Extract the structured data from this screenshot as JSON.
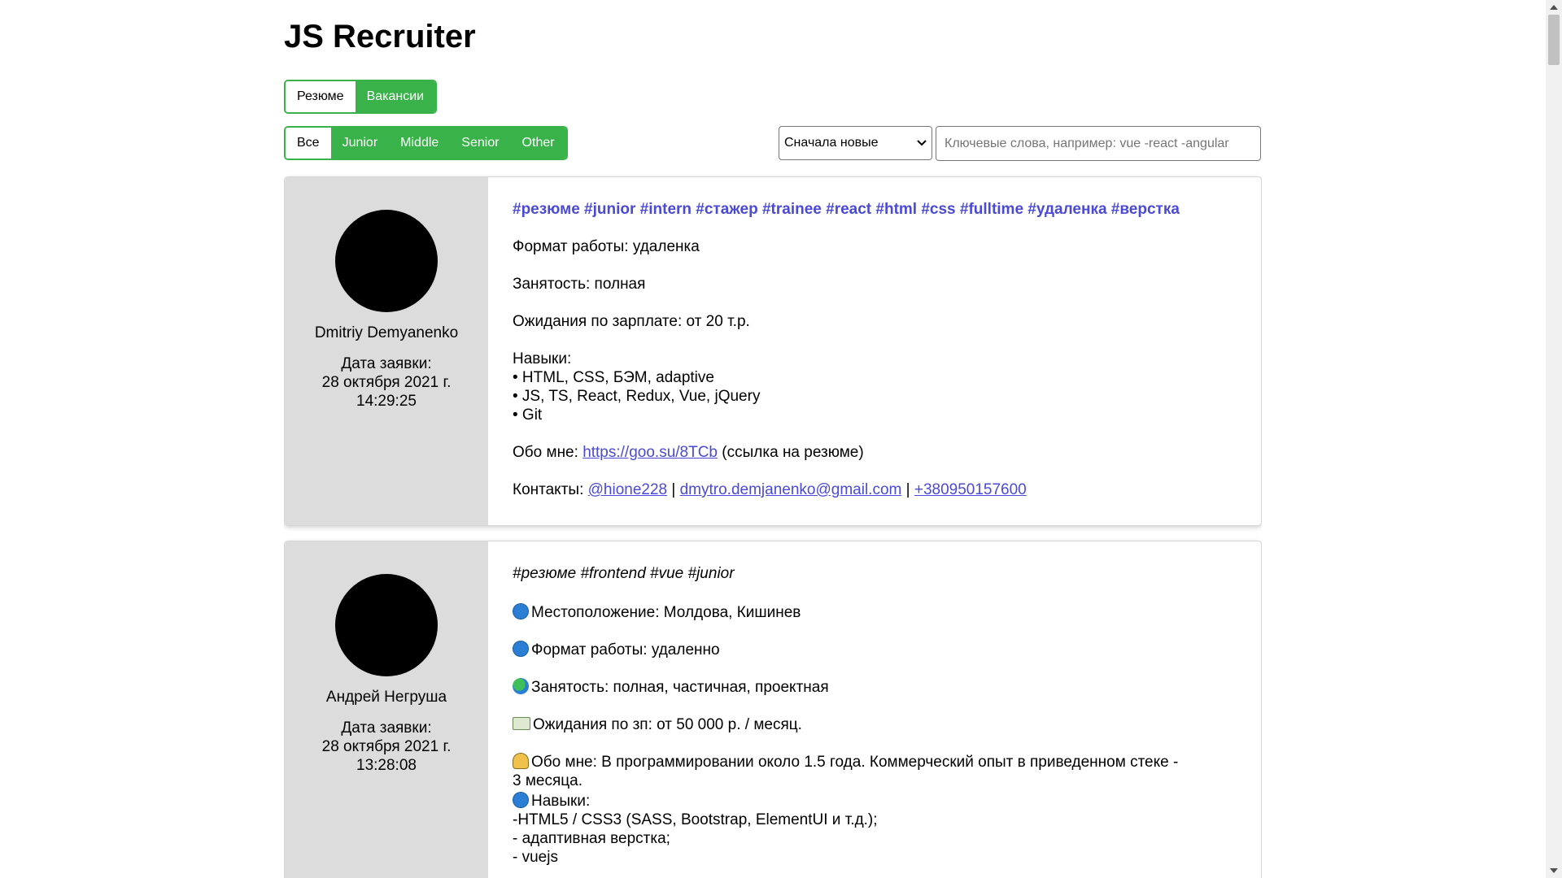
{
  "app": {
    "title": "JS Recruiter"
  },
  "type_tabs": [
    {
      "label": "Резюме",
      "active": false
    },
    {
      "label": "Вакансии",
      "active": true
    }
  ],
  "level_tabs": [
    {
      "label": "Все",
      "active": false
    },
    {
      "label": "Junior",
      "active": true
    },
    {
      "label": "Middle",
      "active": true
    },
    {
      "label": "Senior",
      "active": true
    },
    {
      "label": "Other",
      "active": true
    }
  ],
  "sort": {
    "selected": "Сначала новые"
  },
  "search": {
    "placeholder": "Ключевые слова, например: vue -react -angular",
    "value": ""
  },
  "colors": {
    "accent": "#3ab24a",
    "link": "#4a4ad6",
    "sidebar": "#dcdcdc"
  },
  "posts": [
    {
      "author": "Dmitriy Demyanenko",
      "date_label": "Дата заявки:",
      "date": "28 октября 2021 г.",
      "time": "14:29:25",
      "tags": "#резюме #junior #intern #стажер #trainee #react #html #css #fulltime #удаленка #верстка",
      "format": "Формат работы: удаленка",
      "employment": "Занятость: полная",
      "salary": "Ожидания по зарплате: от 20 т.р.",
      "skills_title": "Навыки:",
      "skills": [
        "• HTML, CSS, БЭМ, adaptive",
        "• JS, TS, React, Redux, Vue, jQuery",
        "• Git"
      ],
      "about_prefix": "Обо мне: ",
      "about_link": "https://goo.su/8TCb",
      "about_suffix": " (ссылка на резюме)",
      "contacts_prefix": "Контакты: ",
      "contact_tg": "@hione228",
      "separator": " | ",
      "contact_email": "dmytro.demjanenko@gmail.com",
      "contact_phone": "+380950157600"
    },
    {
      "author": "Андрей Негруша",
      "date_label": "Дата заявки:",
      "date": "28 октября 2021 г.",
      "time": "13:28:08",
      "tags": "#резюме #frontend #vue #junior",
      "location": "Местоположение: Молдова, Кишинев",
      "format": "Формат работы: удаленно",
      "employment": "Занятость: полная, частичная, проектная",
      "salary": "Ожидания по зп: от 50 000 р. / месяц.",
      "about_1": "Обо мне: В программировании около 1.5 года. Коммерческий опыт в приведенном стеке -",
      "about_2": "3 месяца.",
      "skills_title": "Навыки:",
      "skills": [
        "-HTML5 / CSS3 (SASS, Bootstrap, ElementUI и т.д.);",
        "- адаптивная верстка;",
        "- vuejs"
      ]
    }
  ]
}
